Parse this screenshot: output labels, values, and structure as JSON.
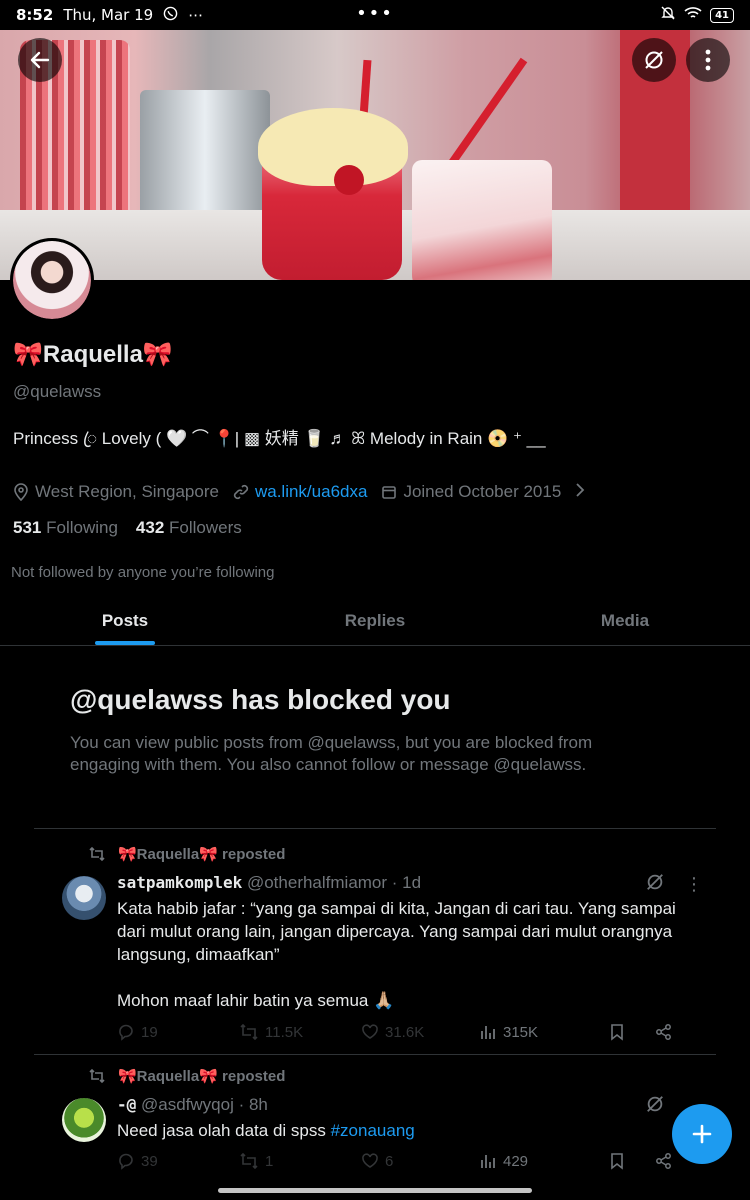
{
  "status_bar": {
    "time": "8:52",
    "date": "Thu, Mar 19",
    "center_dots": "•••",
    "battery": "41"
  },
  "profile": {
    "display_name": "🎀Raquella🎀",
    "handle": "@quelawss",
    "bio": "Princess ꦿ Lovely ( 🤍 ⌒ 📍| ▩ 妖精 🥛 ♬ ꕤ Melody  in  Rain 📀 ⁺ __ ",
    "location": "West Region, Singapore",
    "website": "wa.link/ua6dxa",
    "joined": "Joined October 2015",
    "following_count": "531",
    "following_label": "Following",
    "followers_count": "432",
    "followers_label": "Followers",
    "not_followed_text": "Not followed by anyone you’re following"
  },
  "tabs": [
    {
      "label": "Posts",
      "active": true
    },
    {
      "label": "Replies",
      "active": false
    },
    {
      "label": "Media",
      "active": false
    }
  ],
  "blocked": {
    "title": "@quelawss has blocked you",
    "description": "You can view public posts from @quelawss, but you are blocked from engaging with them. You also cannot follow or message @quelawss."
  },
  "posts": [
    {
      "repost_label": "🎀Raquella🎀 reposted",
      "author_name": "satpamkomplek",
      "author_handle": "@otherhalfmiamor",
      "time": "· 1d",
      "text": "Kata habib jafar : “yang ga sampai di kita, Jangan di cari tau. Yang sampai dari mulut orang lain, jangan dipercaya. Yang sampai dari mulut orangnya langsung, dimaafkan”",
      "text2": "Mohon maaf lahir batin ya semua 🙏🏼",
      "replies": "19",
      "reposts": "11.5K",
      "likes": "31.6K",
      "views": "315K"
    },
    {
      "repost_label": "🎀Raquella🎀 reposted",
      "author_name": "-@",
      "author_handle": "@asdfwyqoj",
      "time": "· 8h",
      "text": "Need jasa olah data di spss",
      "hashtag": "#zonauang",
      "replies": "39",
      "reposts": "1",
      "likes": "6",
      "views": "429"
    }
  ],
  "colors": {
    "accent": "#1d9bf0",
    "text_primary": "#e7e9ea",
    "text_secondary": "#71767b",
    "background": "#000000",
    "divider": "#2f3336"
  }
}
